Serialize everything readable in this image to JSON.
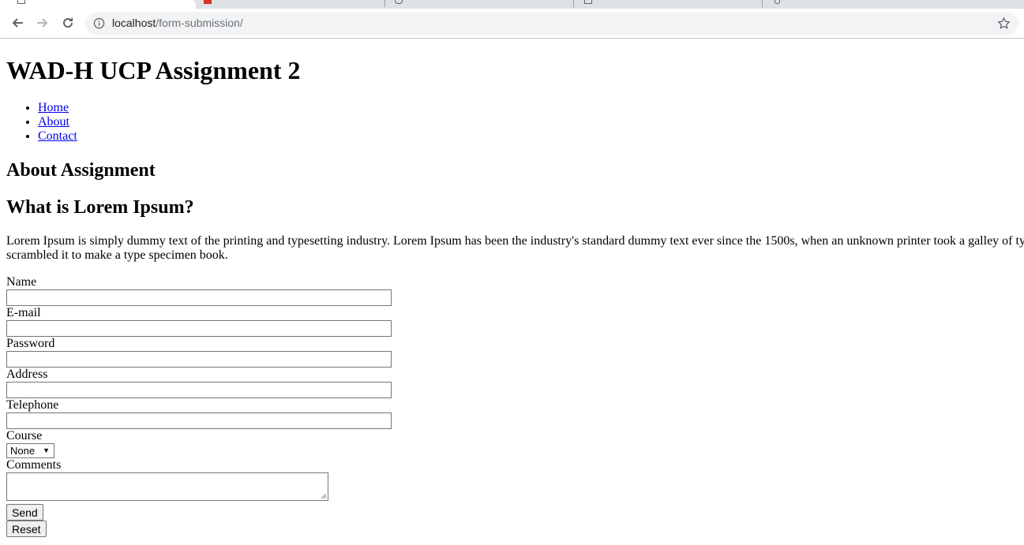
{
  "browser": {
    "url_host": "localhost",
    "url_path": "/form-submission/"
  },
  "page": {
    "heading": "WAD-H UCP Assignment 2",
    "nav": [
      "Home",
      "About",
      "Contact"
    ],
    "section_heading": "About Assignment",
    "subheading": "What is Lorem Ipsum?",
    "paragraph": "Lorem Ipsum is simply dummy text of the printing and typesetting industry. Lorem Ipsum has been the industry's standard dummy text ever since the 1500s, when an unknown printer took a galley of type and scrambled it to make a type specimen book."
  },
  "form": {
    "name_label": "Name",
    "email_label": "E-mail",
    "password_label": "Password",
    "address_label": "Address",
    "telephone_label": "Telephone",
    "course_label": "Course",
    "course_selected": "None",
    "comments_label": "Comments",
    "send_label": "Send",
    "reset_label": "Reset"
  }
}
